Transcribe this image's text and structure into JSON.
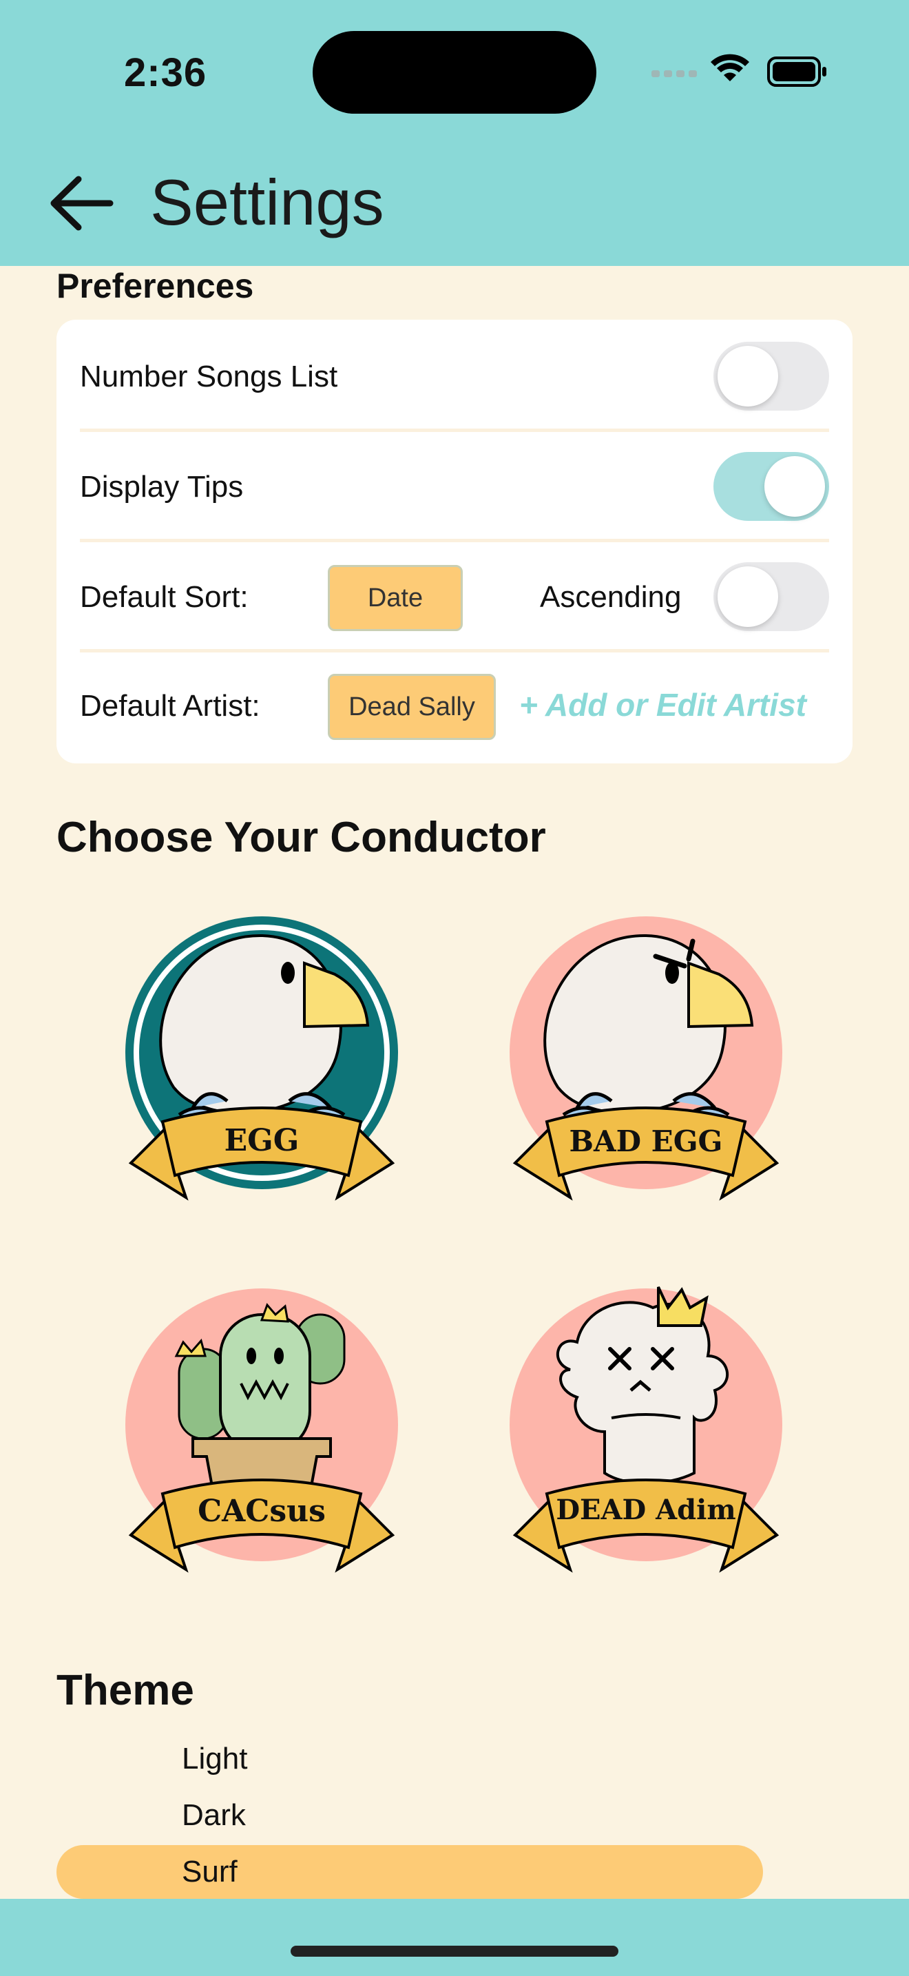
{
  "status_bar": {
    "time": "2:36"
  },
  "header": {
    "title": "Settings"
  },
  "preferences": {
    "heading": "Preferences",
    "number_songs_list": {
      "label": "Number Songs List",
      "enabled": false
    },
    "display_tips": {
      "label": "Display Tips",
      "enabled": true
    },
    "default_sort": {
      "label": "Default Sort:",
      "value": "Date",
      "order_label": "Ascending",
      "ascending": false
    },
    "default_artist": {
      "label": "Default Artist:",
      "value": "Dead Sally",
      "add_edit_label": "+ Add or Edit Artist"
    }
  },
  "conductors": {
    "heading": "Choose Your Conductor",
    "items": [
      {
        "name": "EGG",
        "selected": true
      },
      {
        "name": "BAD EGG",
        "selected": false
      },
      {
        "name": "CACsus",
        "selected": false
      },
      {
        "name": "DEAD Adim",
        "selected": false
      }
    ]
  },
  "theme": {
    "heading": "Theme",
    "options": [
      "Light",
      "Dark",
      "Surf"
    ],
    "selected": "Surf"
  },
  "colors": {
    "header": "#8AD9D7",
    "background": "#FBF3E1",
    "accent_chip": "#FDCB76",
    "toggle_on": "#A8DFDF",
    "badge_pink": "#FDB5AA",
    "badge_teal": "#0D7478",
    "ribbon": "#F1BE48"
  }
}
